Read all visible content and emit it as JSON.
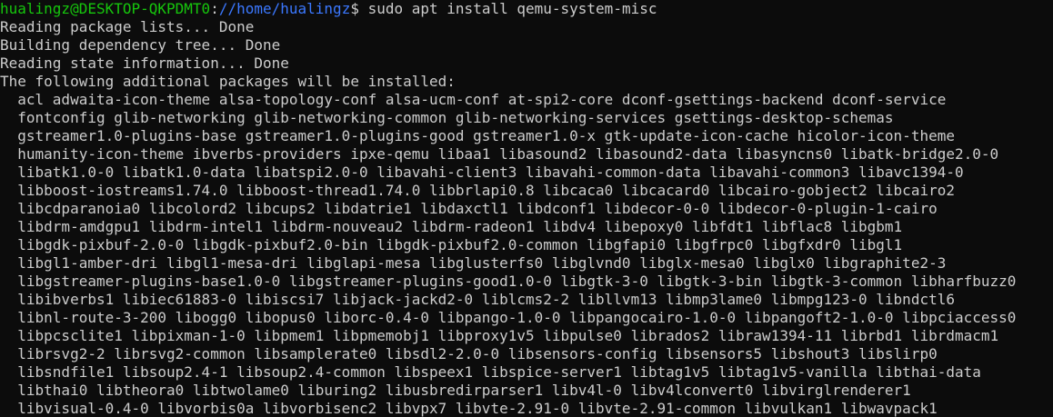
{
  "prompt": {
    "user_host": "hualingz@DESKTOP-QKPDMT0",
    "sep": ":",
    "path": "//home/hualingz",
    "symbol": "$ ",
    "command": "sudo apt install qemu-system-misc"
  },
  "output": [
    "Reading package lists... Done",
    "Building dependency tree... Done",
    "Reading state information... Done",
    "The following additional packages will be installed:",
    "  acl adwaita-icon-theme alsa-topology-conf alsa-ucm-conf at-spi2-core dconf-gsettings-backend dconf-service",
    "  fontconfig glib-networking glib-networking-common glib-networking-services gsettings-desktop-schemas",
    "  gstreamer1.0-plugins-base gstreamer1.0-plugins-good gstreamer1.0-x gtk-update-icon-cache hicolor-icon-theme",
    "  humanity-icon-theme ibverbs-providers ipxe-qemu libaa1 libasound2 libasound2-data libasyncns0 libatk-bridge2.0-0",
    "  libatk1.0-0 libatk1.0-data libatspi2.0-0 libavahi-client3 libavahi-common-data libavahi-common3 libavc1394-0",
    "  libboost-iostreams1.74.0 libboost-thread1.74.0 libbrlapi0.8 libcaca0 libcacard0 libcairo-gobject2 libcairo2",
    "  libcdparanoia0 libcolord2 libcups2 libdatrie1 libdaxctl1 libdconf1 libdecor-0-0 libdecor-0-plugin-1-cairo",
    "  libdrm-amdgpu1 libdrm-intel1 libdrm-nouveau2 libdrm-radeon1 libdv4 libepoxy0 libfdt1 libflac8 libgbm1",
    "  libgdk-pixbuf-2.0-0 libgdk-pixbuf2.0-bin libgdk-pixbuf2.0-common libgfapi0 libgfrpc0 libgfxdr0 libgl1",
    "  libgl1-amber-dri libgl1-mesa-dri libglapi-mesa libglusterfs0 libglvnd0 libglx-mesa0 libglx0 libgraphite2-3",
    "  libgstreamer-plugins-base1.0-0 libgstreamer-plugins-good1.0-0 libgtk-3-0 libgtk-3-bin libgtk-3-common libharfbuzz0",
    "  libibverbs1 libiec61883-0 libiscsi7 libjack-jackd2-0 liblcms2-2 libllvm13 libmp3lame0 libmpg123-0 libndctl6",
    "  libnl-route-3-200 libogg0 libopus0 liborc-0.4-0 libpango-1.0-0 libpangocairo-1.0-0 libpangoft2-1.0-0 libpciaccess0",
    "  libpcsclite1 libpixman-1-0 libpmem1 libpmemobj1 libproxy1v5 libpulse0 librados2 libraw1394-11 librbd1 librdmacm1",
    "  librsvg2-2 librsvg2-common libsamplerate0 libsdl2-2.0-0 libsensors-config libsensors5 libshout3 libslirp0",
    "  libsndfile1 libsoup2.4-1 libsoup2.4-common libspeex1 libspice-server1 libtag1v5 libtag1v5-vanilla libthai-data",
    "  libthai0 libtheora0 libtwolame0 liburing2 libusbredirparser1 libv4l-0 libv4lconvert0 libvirglrenderer1",
    "  libvisual-0.4-0 libvorbis0a libvorbisenc2 libvpx7 libvte-2.91-0 libvte-2.91-common libvulkan1 libwavpack1"
  ]
}
